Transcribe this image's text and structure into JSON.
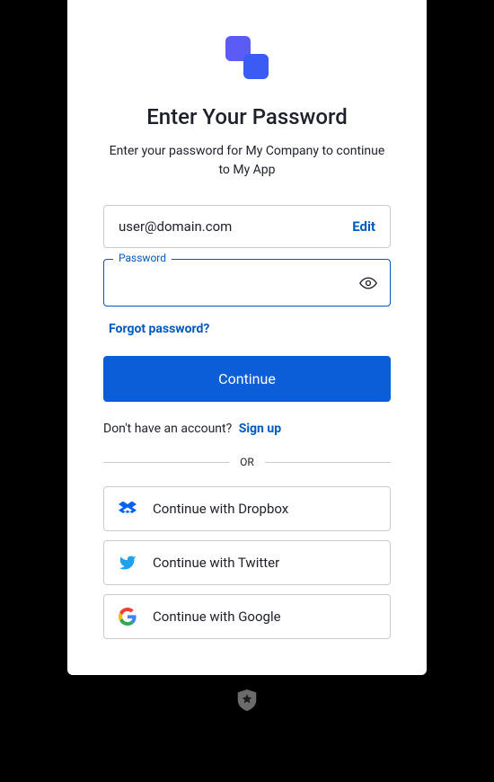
{
  "header": {
    "title": "Enter Your Password",
    "subtitle": "Enter your password for My Company to continue to My App"
  },
  "email": {
    "value": "user@domain.com",
    "edit_label": "Edit"
  },
  "password": {
    "label": "Password",
    "value": ""
  },
  "links": {
    "forgot": "Forgot password?",
    "signup_prompt": "Don't have an account?",
    "signup": "Sign up"
  },
  "buttons": {
    "continue": "Continue"
  },
  "divider": {
    "text": "OR"
  },
  "social": {
    "dropbox": "Continue with Dropbox",
    "twitter": "Continue with Twitter",
    "google": "Continue with Google"
  }
}
